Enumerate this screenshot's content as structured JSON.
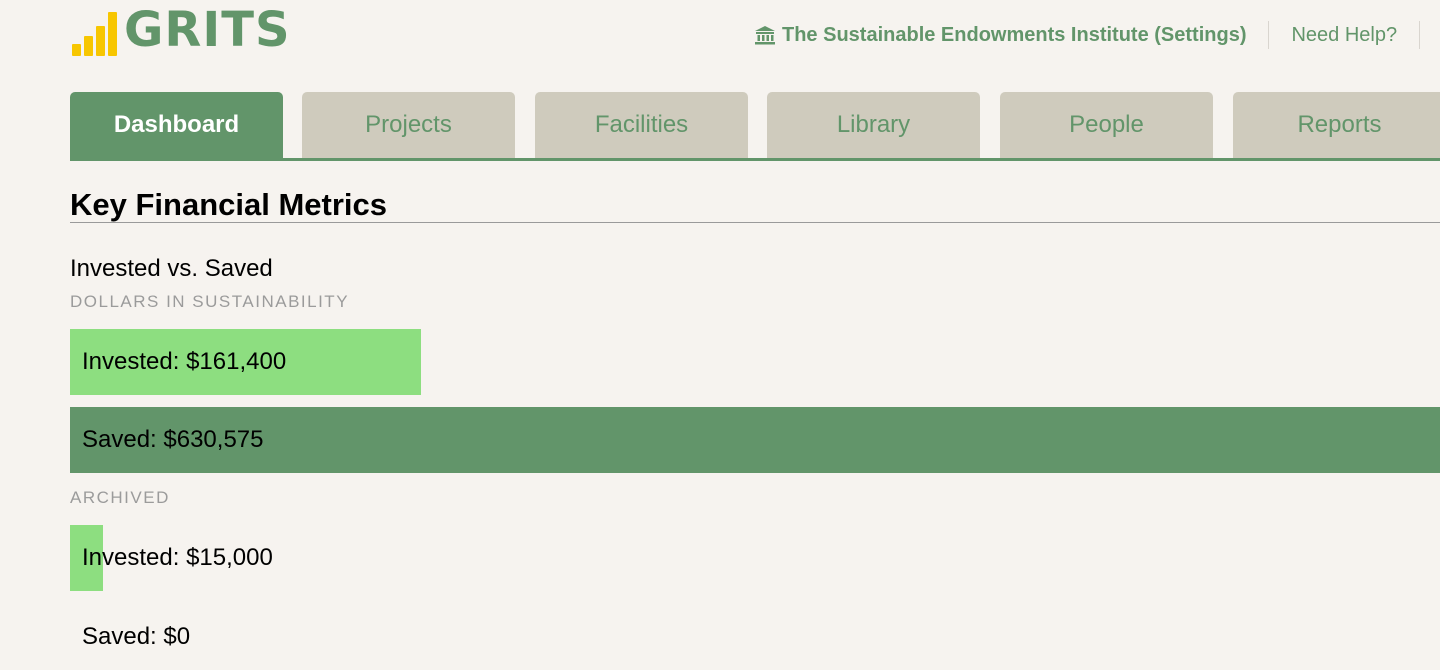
{
  "header": {
    "logo_text": "GRITS",
    "org_link": "The Sustainable Endowments Institute (Settings)",
    "help_link": "Need Help?"
  },
  "tabs": [
    {
      "label": "Dashboard",
      "active": true
    },
    {
      "label": "Projects",
      "active": false
    },
    {
      "label": "Facilities",
      "active": false
    },
    {
      "label": "Library",
      "active": false
    },
    {
      "label": "People",
      "active": false
    },
    {
      "label": "Reports",
      "active": false
    }
  ],
  "main": {
    "section_title": "Key Financial Metrics",
    "chart_title": "Invested vs. Saved",
    "groups": [
      {
        "label": "DOLLARS IN SUSTAINABILITY",
        "bars": [
          {
            "label": "Invested: $161,400",
            "kind": "invested",
            "value": 161400
          },
          {
            "label": "Saved: $630,575",
            "kind": "saved",
            "value": 630575
          }
        ]
      },
      {
        "label": "ARCHIVED",
        "bars": [
          {
            "label": "Invested: $15,000",
            "kind": "invested",
            "value": 15000
          },
          {
            "label": "Saved: $0",
            "kind": "saved",
            "value": 0
          }
        ]
      }
    ]
  },
  "colors": {
    "brand_green": "#62956a",
    "invested_green": "#8dde80",
    "logo_yellow": "#f7c600",
    "tab_inactive": "#cfcbbd",
    "background": "#f6f3ef"
  },
  "chart_data": {
    "type": "bar",
    "title": "Invested vs. Saved",
    "categories": [
      "DOLLARS IN SUSTAINABILITY",
      "ARCHIVED"
    ],
    "series": [
      {
        "name": "Invested",
        "values": [
          161400,
          15000
        ]
      },
      {
        "name": "Saved",
        "values": [
          630575,
          0
        ]
      }
    ]
  }
}
